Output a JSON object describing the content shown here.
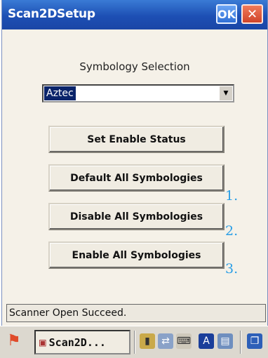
{
  "window": {
    "title": "Scan2DSetup",
    "ok_label": "OK",
    "close_label": "✕"
  },
  "symbology": {
    "label": "Symbology Selection",
    "selected": "Aztec"
  },
  "buttons": {
    "set_enable": "Set Enable Status",
    "default_all": "Default All Symbologies",
    "disable_all": "Disable All Symbologies",
    "enable_all": "Enable All Symbologies"
  },
  "annotations": [
    "1.",
    "2.",
    "3."
  ],
  "status": "Scanner Open Succeed.",
  "taskbar": {
    "task_label": "Scan2D...",
    "start_icon": "windows-flag-icon"
  },
  "colors": {
    "titlebar": "#1d4fb4",
    "selection": "#0a246a",
    "annotation": "#2b9fe6",
    "close": "#d0452a"
  }
}
